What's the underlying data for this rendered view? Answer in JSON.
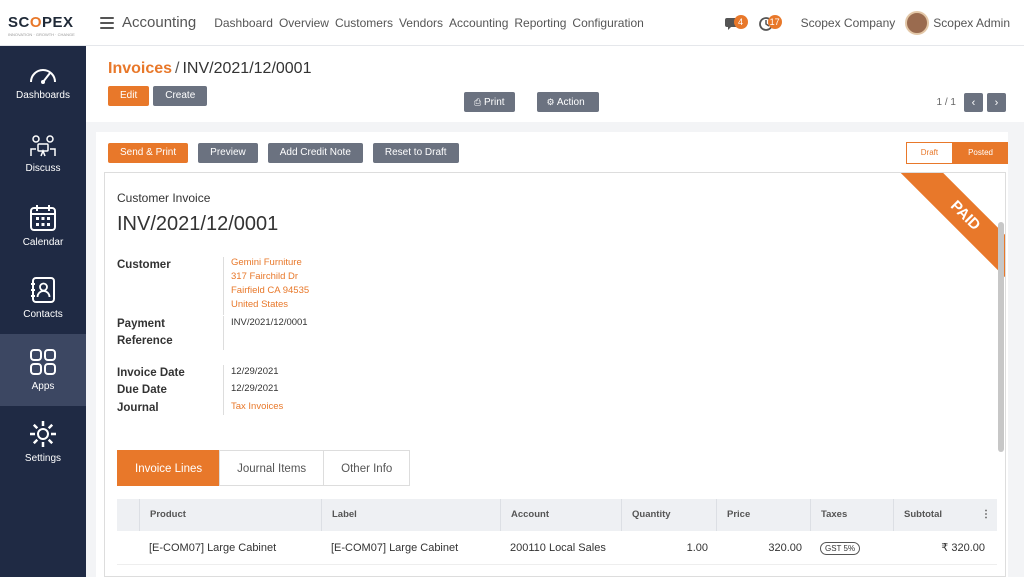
{
  "brand": {
    "logo_prefix": "SC",
    "logo_o": "O",
    "logo_suffix": "PEX",
    "tagline": "INNOVATION · GROWTH · CHANGE"
  },
  "app_title": "Accounting",
  "nav": [
    "Dashboard",
    "Overview",
    "Customers",
    "Vendors",
    "Accounting",
    "Reporting",
    "Configuration"
  ],
  "badges": {
    "messages": "4",
    "activities": "17"
  },
  "company": "Scopex Company",
  "user": "Scopex Admin",
  "sidebar": [
    {
      "label": "Dashboards",
      "icon": "gauge-icon"
    },
    {
      "label": "Discuss",
      "icon": "discuss-icon"
    },
    {
      "label": "Calendar",
      "icon": "calendar-icon"
    },
    {
      "label": "Contacts",
      "icon": "contacts-icon"
    },
    {
      "label": "Apps",
      "icon": "apps-icon"
    },
    {
      "label": "Settings",
      "icon": "gear-icon"
    }
  ],
  "breadcrumb": {
    "parent": "Invoices",
    "separator": "/",
    "current": "INV/2021/12/0001"
  },
  "header_buttons": {
    "edit": "Edit",
    "create": "Create",
    "print": "Print",
    "action": "Action"
  },
  "pager": {
    "text": "1 / 1"
  },
  "status_buttons": {
    "send_print": "Send & Print",
    "preview": "Preview",
    "credit_note": "Add Credit Note",
    "reset": "Reset to Draft"
  },
  "statusbar": {
    "draft": "Draft",
    "posted": "Posted"
  },
  "ribbon": "PAID",
  "invoice": {
    "type_label": "Customer Invoice",
    "number": "INV/2021/12/0001",
    "customer_label": "Customer",
    "customer_lines": [
      "Gemini Furniture",
      "317 Fairchild Dr",
      "Fairfield CA 94535",
      "United States"
    ],
    "payment_ref_label_1": "Payment",
    "payment_ref_label_2": "Reference",
    "payment_ref": "INV/2021/12/0001",
    "invoice_date_label": "Invoice Date",
    "invoice_date": "12/29/2021",
    "due_date_label": "Due Date",
    "due_date": "12/29/2021",
    "journal_label": "Journal",
    "journal": "Tax Invoices"
  },
  "tabs": [
    "Invoice Lines",
    "Journal Items",
    "Other Info"
  ],
  "table": {
    "headers": [
      "Product",
      "Label",
      "Account",
      "Quantity",
      "Price",
      "Taxes",
      "Subtotal"
    ],
    "rows": [
      {
        "product": "[E-COM07] Large Cabinet",
        "label": "[E-COM07] Large Cabinet",
        "account": "200110 Local Sales",
        "quantity": "1.00",
        "price": "320.00",
        "taxes": "GST 5%",
        "subtotal": "₹ 320.00"
      }
    ]
  },
  "colors": {
    "accent": "#e8782a",
    "sidebar": "#1f2a44",
    "button_gray": "#6b7280"
  }
}
